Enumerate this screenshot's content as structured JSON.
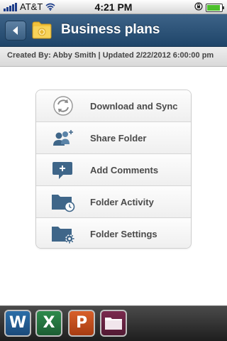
{
  "status_bar": {
    "carrier": "AT&T",
    "time": "4:21 PM",
    "icons": [
      "signal-icon",
      "wifi-icon",
      "orientation-lock-icon",
      "battery-icon"
    ]
  },
  "nav": {
    "title": "Business plans",
    "back_icon": "chevron-left-icon",
    "folder_icon": "folder-icon",
    "bar_color": "#2b5176"
  },
  "info": {
    "text": "Created By: Abby Smith | Updated 2/22/2012 6:00:00 pm"
  },
  "menu": {
    "items": [
      {
        "label": "Download and Sync",
        "icon": "sync-icon"
      },
      {
        "label": "Share Folder",
        "icon": "share-users-icon"
      },
      {
        "label": "Add Comments",
        "icon": "comment-add-icon"
      },
      {
        "label": "Folder Activity",
        "icon": "folder-clock-icon"
      },
      {
        "label": "Folder Settings",
        "icon": "folder-gear-icon"
      }
    ],
    "icon_color": "#3f6689"
  },
  "dock": {
    "apps": [
      {
        "letter": "W",
        "icon": "word-app-icon"
      },
      {
        "letter": "X",
        "icon": "excel-app-icon"
      },
      {
        "letter": "P",
        "icon": "powerpoint-app-icon"
      },
      {
        "letter": "",
        "icon": "files-app-icon"
      }
    ]
  }
}
